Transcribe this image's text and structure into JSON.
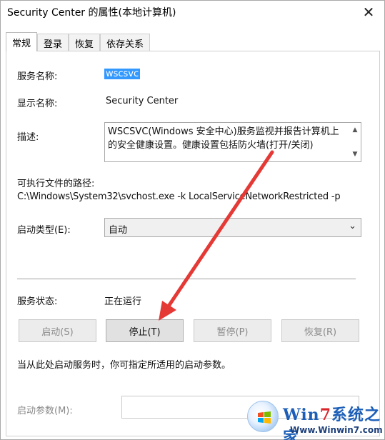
{
  "window": {
    "title": "Security Center 的属性(本地计算机)",
    "close_glyph": "✕"
  },
  "tabs": [
    {
      "label": "常规"
    },
    {
      "label": "登录"
    },
    {
      "label": "恢复"
    },
    {
      "label": "依存关系"
    }
  ],
  "general": {
    "service_name_label": "服务名称:",
    "service_name_value": "wscsvc",
    "display_name_label": "显示名称:",
    "display_name_value": "Security Center",
    "description_label": "描述:",
    "description_value": "WSCSVC(Windows 安全中心)服务监视并报告计算机上的安全健康设置。健康设置包括防火墙(打开/关闭)",
    "exe_path_label": "可执行文件的路径:",
    "exe_path_value": "C:\\Windows\\System32\\svchost.exe -k LocalServiceNetworkRestricted -p",
    "startup_type_label": "启动类型(E):",
    "startup_type_value": "自动",
    "service_status_label": "服务状态:",
    "service_status_value": "正在运行",
    "buttons": {
      "start": "启动(S)",
      "stop": "停止(T)",
      "pause": "暂停(P)",
      "resume": "恢复(R)"
    },
    "hint_text": "当从此处启动服务时，你可指定所适用的启动参数。",
    "start_params_label": "启动参数(M):",
    "start_params_value": ""
  },
  "watermark": {
    "brand_prefix": "Win",
    "brand_number": "7",
    "brand_suffix": "系统之家",
    "url": "Www.Winwin7.com"
  },
  "colors": {
    "annotation_arrow": "#e53935",
    "selection": "#3399ff"
  }
}
